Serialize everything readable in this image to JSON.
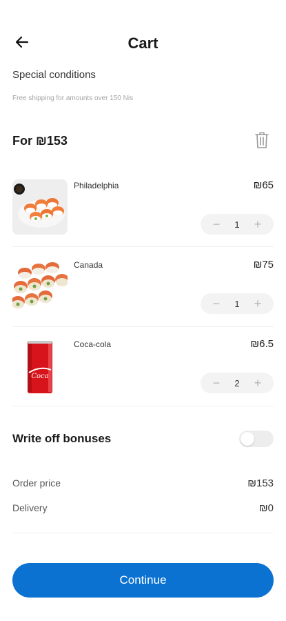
{
  "header": {
    "title": "Cart",
    "back_icon": "arrow-left-icon"
  },
  "conditions": {
    "title": "Special conditions",
    "subtitle": "Free shipping for amounts over 150 Nis"
  },
  "cart_total": {
    "label": "For ₪153",
    "clear_icon": "trash-icon"
  },
  "items": [
    {
      "name": "Philadelphia",
      "price": "₪65",
      "quantity": "1",
      "image": "sushi-roll-salmon"
    },
    {
      "name": "Canada",
      "price": "₪75",
      "quantity": "1",
      "image": "sushi-roll-canada"
    },
    {
      "name": "Coca-cola",
      "price": "₪6.5",
      "quantity": "2",
      "image": "coca-cola-can"
    }
  ],
  "stepper": {
    "minus": "−",
    "plus": "+"
  },
  "bonuses": {
    "label": "Write off bonuses",
    "enabled": false
  },
  "summary": {
    "order_price_label": "Order price",
    "order_price_value": "₪153",
    "delivery_label": "Delivery",
    "delivery_value": "₪0"
  },
  "continue_label": "Continue",
  "colors": {
    "accent": "#0b72d2",
    "stepper_bg": "#f3f3f3"
  }
}
